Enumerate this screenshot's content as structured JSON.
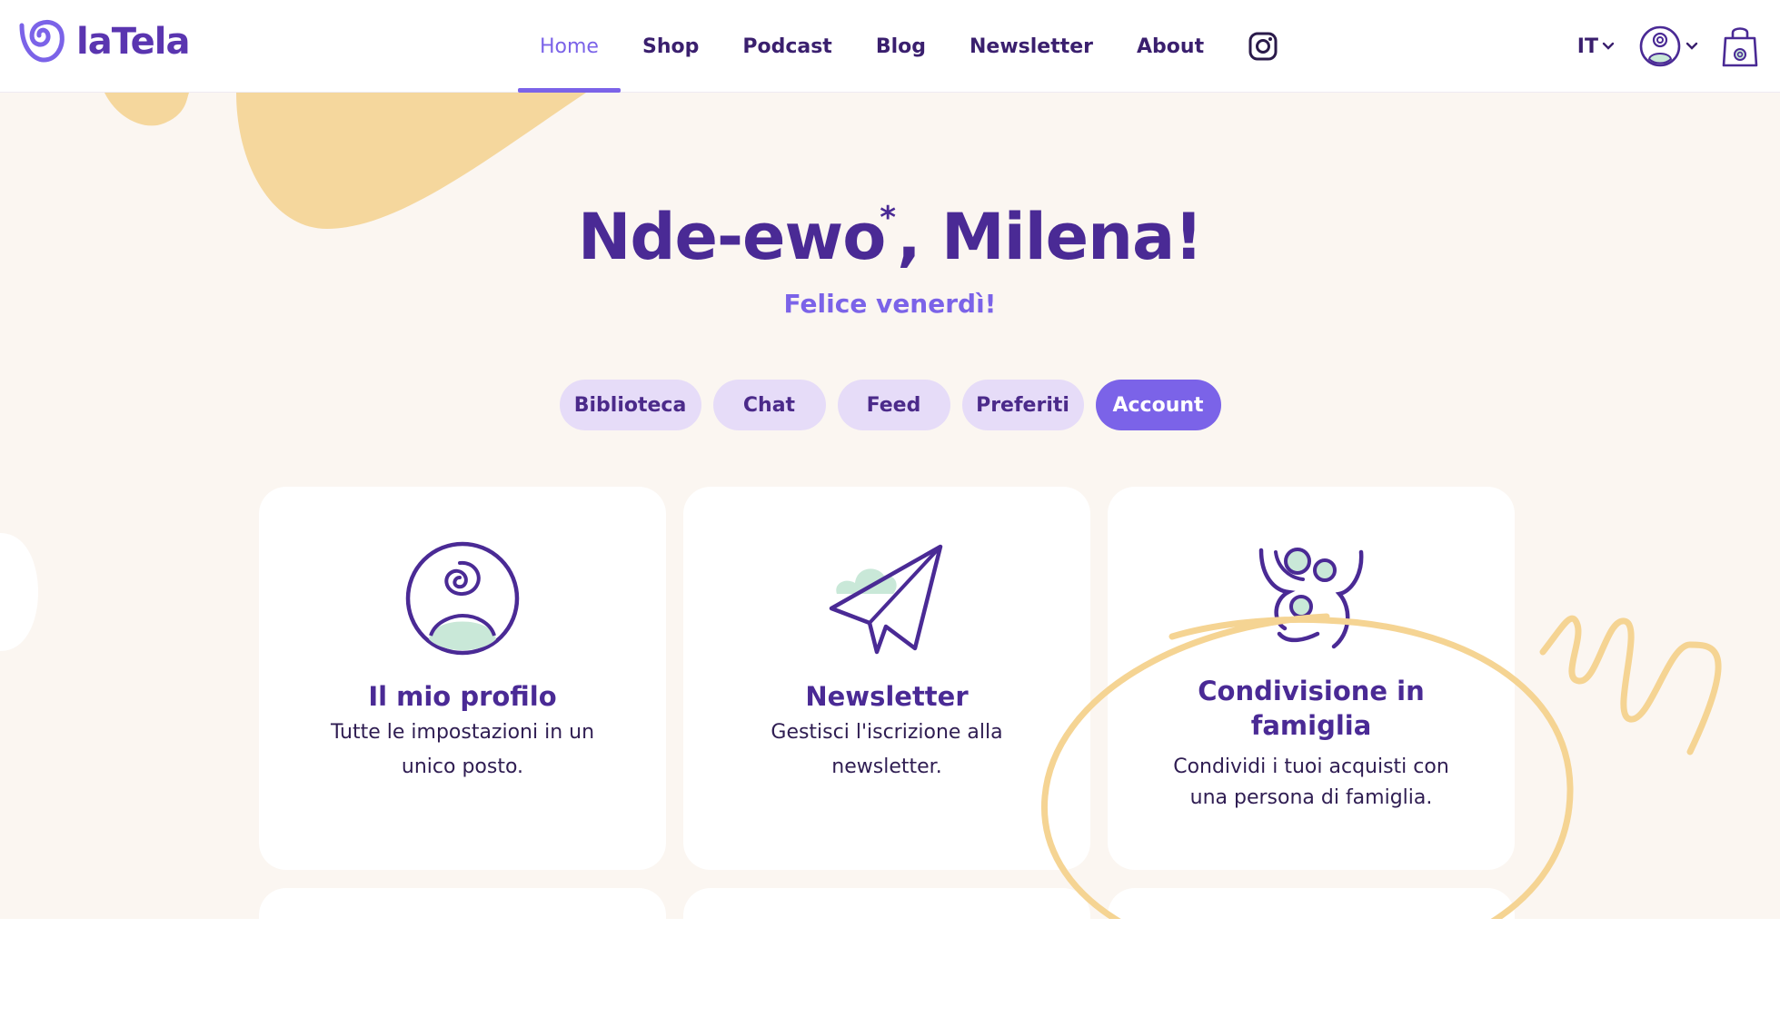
{
  "brand": {
    "name": "laTela",
    "accent": "#7b63e8",
    "deep": "#4a2a95",
    "highlight": "#f5d493"
  },
  "nav": {
    "items": [
      {
        "label": "Home",
        "active": true
      },
      {
        "label": "Shop"
      },
      {
        "label": "Podcast"
      },
      {
        "label": "Blog"
      },
      {
        "label": "Newsletter"
      },
      {
        "label": "About"
      }
    ],
    "social_icon": "instagram-icon"
  },
  "header_tools": {
    "language": "IT",
    "user_icon": "user-avatar-icon",
    "cart_icon": "shopping-bag-icon"
  },
  "greeting": {
    "word": "Nde-ewo",
    "asterisk": "*",
    "name": ", Milena!",
    "subtitle": "Felice venerdì!"
  },
  "tabs": [
    {
      "label": "Biblioteca"
    },
    {
      "label": "Chat"
    },
    {
      "label": "Feed"
    },
    {
      "label": "Preferiti"
    },
    {
      "label": "Account",
      "active": true
    }
  ],
  "cards": [
    {
      "icon": "profile-icon",
      "title": "Il mio profilo",
      "desc_line1": "Tutte le impostazioni in un",
      "desc_line2": "unico posto."
    },
    {
      "icon": "paper-plane-icon",
      "title": "Newsletter",
      "desc_line1": "Gestisci l'iscrizione alla",
      "desc_line2": "newsletter."
    },
    {
      "icon": "family-icon",
      "title_line1": "Condivisione in",
      "title_line2": "famiglia",
      "desc_line1": "Condividi i tuoi acquisti con",
      "desc_line2": "una persona di famiglia."
    }
  ]
}
